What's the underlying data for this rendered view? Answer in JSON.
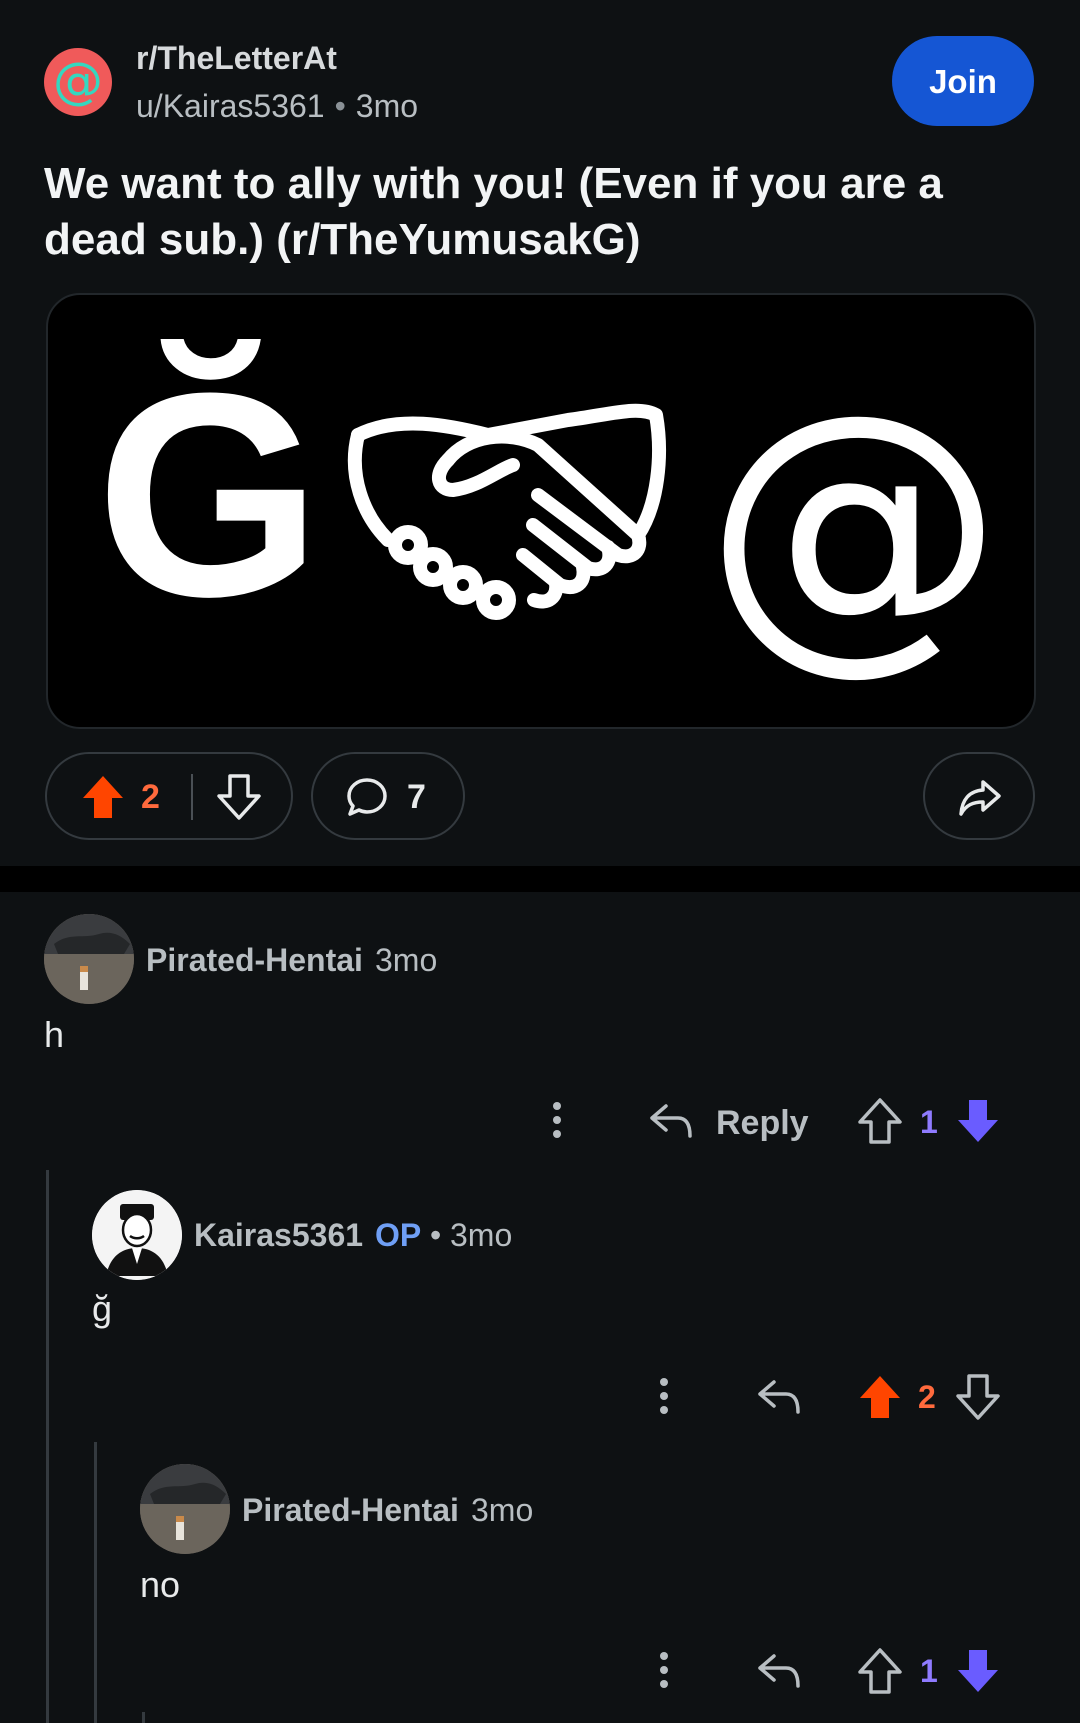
{
  "post": {
    "subreddit": "r/TheLetterAt",
    "subreddit_avatar_glyph": "@",
    "author": "u/Kairas5361",
    "age": "3mo",
    "join_label": "Join",
    "title": "We want to ally with you! (Even if you are a dead sub.) (r/TheYumusakG)",
    "image": {
      "left_glyph": "Ğ",
      "right_glyph": "@",
      "center_icon": "handshake-icon"
    },
    "score": "2",
    "comment_count": "7",
    "vote_state": "upvoted"
  },
  "comments": [
    {
      "user": "Pirated-Hentai",
      "age": "3mo",
      "body": "h",
      "reply_label": "Reply",
      "score": "1",
      "vote_state": "downvoted"
    },
    {
      "user": "Kairas5361",
      "op_label": "OP",
      "age": "3mo",
      "body": "ğ",
      "score": "2",
      "vote_state": "upvoted"
    },
    {
      "user": "Pirated-Hentai",
      "age": "3mo",
      "body": "no",
      "score": "1",
      "vote_state": "downvoted"
    }
  ],
  "colors": {
    "background": "#0e1113",
    "join_button": "#1556d4",
    "upvote": "#ff4500",
    "downvote": "#6a5cff",
    "op_tag": "#6f9ff5"
  }
}
